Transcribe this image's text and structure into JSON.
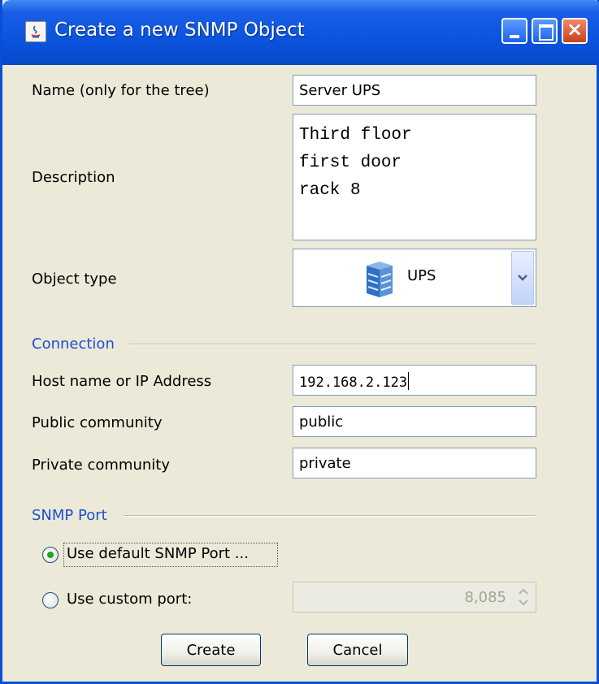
{
  "window": {
    "title": "Create a new SNMP Object",
    "app_icon": "java-icon"
  },
  "form": {
    "name_label": "Name (only for the tree)",
    "name_value": "Server UPS",
    "description_label": "Description",
    "description_lines": [
      "Third floor",
      "first door",
      "rack 8"
    ],
    "object_type_label": "Object type",
    "object_type_value": "UPS",
    "object_type_icon": "server-stack-icon"
  },
  "connection": {
    "section_label": "Connection",
    "host_label": "Host name or IP Address",
    "host_value": "192.168.2.123",
    "public_label": "Public community",
    "public_value": "public",
    "private_label": "Private community",
    "private_value": "private"
  },
  "snmp_port": {
    "section_label": "SNMP Port",
    "default_option_label": "Use default SNMP Port ...",
    "default_selected": true,
    "custom_option_label": "Use custom port:",
    "custom_port_value": "8,085",
    "custom_port_enabled": false
  },
  "buttons": {
    "create": "Create",
    "cancel": "Cancel"
  },
  "colors": {
    "titlebar": "#0a54de",
    "section": "#1c4ed0",
    "window_bg": "#ece9d8",
    "radio_selected": "#21a121"
  }
}
